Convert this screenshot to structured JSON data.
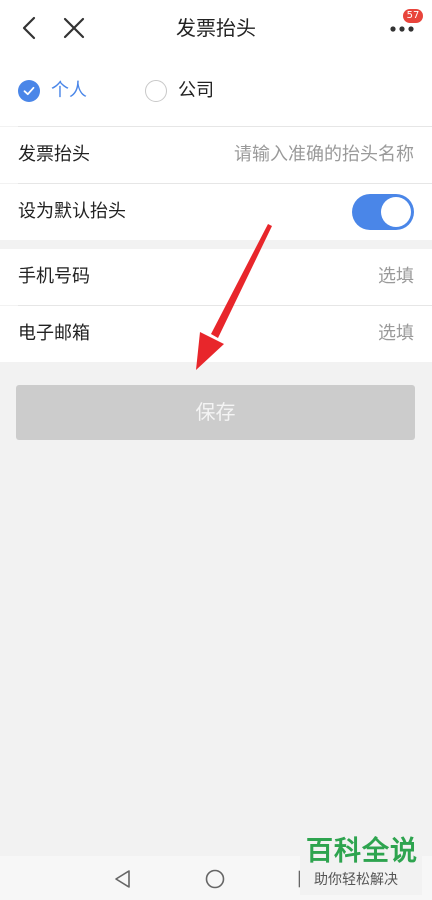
{
  "header": {
    "title": "发票抬头",
    "more_badge": "57"
  },
  "invoice_type": {
    "options": [
      {
        "label": "个人",
        "selected": true
      },
      {
        "label": "公司",
        "selected": false
      }
    ]
  },
  "fields": {
    "invoice_title": {
      "label": "发票抬头",
      "placeholder": "请输入准确的抬头名称"
    },
    "default_title": {
      "label": "设为默认抬头",
      "enabled": true
    },
    "phone": {
      "label": "手机号码",
      "placeholder": "选填"
    },
    "email": {
      "label": "电子邮箱",
      "placeholder": "选填"
    }
  },
  "actions": {
    "save_label": "保存"
  },
  "watermark": {
    "title": "百科全说",
    "subtitle": "助你轻松解决"
  },
  "colors": {
    "accent": "#4a86e8",
    "badge": "#e8443b",
    "disabled_button": "#cccccc",
    "annotation_arrow": "#e8262b"
  }
}
